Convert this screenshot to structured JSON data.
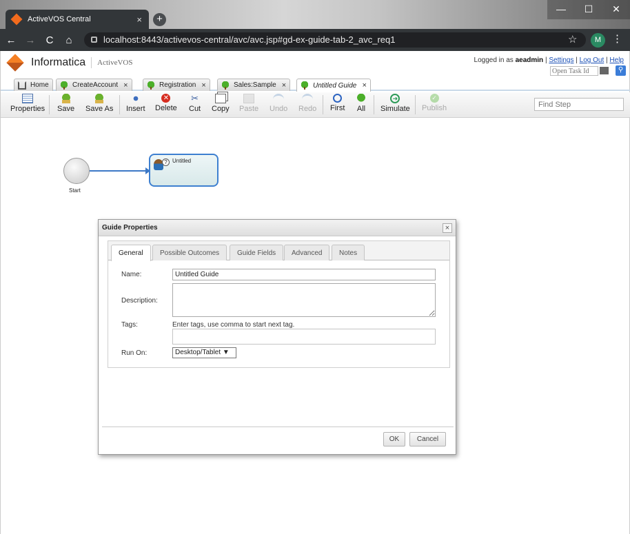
{
  "browser": {
    "tab_title": "ActiveVOS Central",
    "tab_close": "×",
    "new_tab": "+",
    "url": "localhost:8443/activevos-central/avc/avc.jsp#gd-ex-guide-tab-2_avc_req1",
    "profile_initial": "M",
    "controls": {
      "minimize": "—",
      "maximize": "☐",
      "close": "✕"
    },
    "nav": {
      "back": "←",
      "forward": "→",
      "reload": "C",
      "home": "⌂",
      "star": "☆",
      "menu": "⋮"
    }
  },
  "header": {
    "brand": "Informatica",
    "product": "ActiveVOS",
    "logged_in_prefix": "Logged in as",
    "user": "aeadmin",
    "settings": "Settings",
    "logout": "Log Out",
    "help": "Help",
    "divider": "|",
    "task_placeholder": "Open Task Id"
  },
  "tabs": [
    {
      "label": "Home",
      "icon": "home-icon"
    },
    {
      "label": "CreateAccount",
      "icon": "tree-icon",
      "close": "×"
    },
    {
      "label": "Registration",
      "icon": "tree-icon",
      "close": "×"
    },
    {
      "label": "Sales:Sample",
      "icon": "tree-icon",
      "close": "×"
    },
    {
      "label": "Untitled Guide",
      "icon": "tree-icon",
      "close": "×",
      "active": true
    }
  ],
  "toolbar": {
    "properties": "Properties",
    "save": "Save",
    "save_as": "Save As",
    "insert": "Insert",
    "delete": "Delete",
    "cut": "Cut",
    "copy": "Copy",
    "paste": "Paste",
    "undo": "Undo",
    "redo": "Redo",
    "first": "First",
    "all": "All",
    "simulate": "Simulate",
    "publish": "Publish",
    "find_placeholder": "Find Step"
  },
  "canvas": {
    "start_label": "Start",
    "step_label": "Untitled",
    "step_badge": "?"
  },
  "dialog": {
    "title": "Guide Properties",
    "close": "×",
    "tabs": [
      "General",
      "Possible Outcomes",
      "Guide Fields",
      "Advanced",
      "Notes"
    ],
    "name_label": "Name:",
    "name_value": "Untitled Guide",
    "description_label": "Description:",
    "tags_label": "Tags:",
    "tags_hint": "Enter tags, use comma to start next tag.",
    "run_on_label": "Run On:",
    "run_on_value": "Desktop/Tablet ▼",
    "ok": "OK",
    "cancel": "Cancel"
  },
  "colors": {
    "accent": "#3d7fd0",
    "brand_orange": "#f58025",
    "delete_red": "#d62d20"
  }
}
